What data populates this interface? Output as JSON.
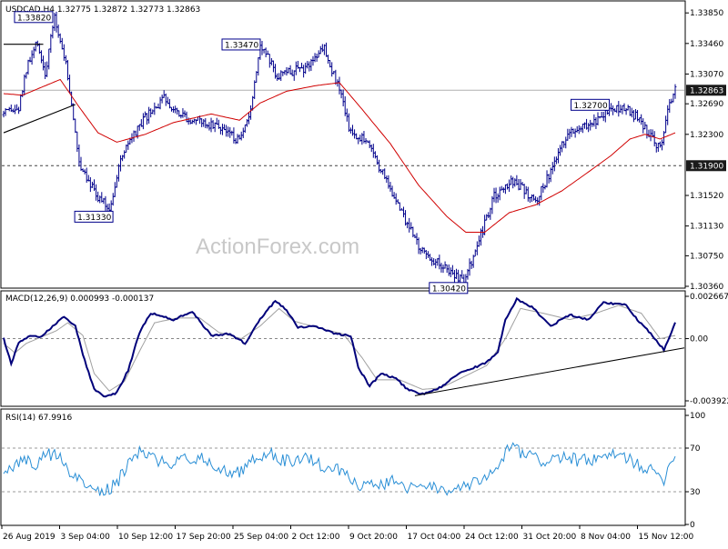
{
  "watermark": "ActionForex.com",
  "colors": {
    "price": "#00008b",
    "ma": "#d00000",
    "macd": "#00007a",
    "signal": "#a0a0a0",
    "rsi": "#2a8fd6",
    "trend": "#000000",
    "level_box": "#1a1a1a",
    "label_border": "#00008b"
  },
  "chart_data": [
    {
      "type": "bar",
      "title": "USDCAD,H4  1.32775 1.32872 1.32773 1.32863",
      "ylim": [
        1.3036,
        1.3398
      ],
      "yticks": [
        "1.33850",
        "1.33460",
        "1.33070",
        "1.32690",
        "1.32300",
        "1.31520",
        "1.31130",
        "1.30750",
        "1.30360"
      ],
      "ytick_values": [
        1.3385,
        1.3346,
        1.3307,
        1.3269,
        1.323,
        1.3152,
        1.3113,
        1.3075,
        1.3036
      ],
      "xtick_labels": [
        "26 Aug 2019",
        "3 Sep 04:00",
        "10 Sep 12:00",
        "17 Sep 20:00",
        "25 Sep 04:00",
        "2 Oct 12:00",
        "9 Oct 20:00",
        "17 Oct 04:00",
        "24 Oct 12:00",
        "31 Oct 20:00",
        "8 Nov 04:00",
        "15 Nov 12:00"
      ],
      "price_keypoints": [
        [
          0,
          1.3255
        ],
        [
          8,
          1.3262
        ],
        [
          12,
          1.3312
        ],
        [
          18,
          1.3348
        ],
        [
          22,
          1.3305
        ],
        [
          27,
          1.338
        ],
        [
          33,
          1.332
        ],
        [
          40,
          1.3195
        ],
        [
          50,
          1.315
        ],
        [
          56,
          1.3135
        ],
        [
          63,
          1.3205
        ],
        [
          75,
          1.325
        ],
        [
          85,
          1.3275
        ],
        [
          98,
          1.325
        ],
        [
          115,
          1.324
        ],
        [
          125,
          1.322
        ],
        [
          130,
          1.3248
        ],
        [
          136,
          1.3347
        ],
        [
          145,
          1.3305
        ],
        [
          160,
          1.3315
        ],
        [
          170,
          1.3342
        ],
        [
          178,
          1.3285
        ],
        [
          184,
          1.3232
        ],
        [
          192,
          1.3225
        ],
        [
          200,
          1.3185
        ],
        [
          212,
          1.3125
        ],
        [
          222,
          1.308
        ],
        [
          232,
          1.3064
        ],
        [
          244,
          1.3042
        ],
        [
          252,
          1.3094
        ],
        [
          260,
          1.315
        ],
        [
          270,
          1.317
        ],
        [
          282,
          1.3145
        ],
        [
          290,
          1.3182
        ],
        [
          300,
          1.3236
        ],
        [
          312,
          1.3245
        ],
        [
          322,
          1.3261
        ],
        [
          330,
          1.3266
        ],
        [
          337,
          1.3247
        ],
        [
          344,
          1.3225
        ],
        [
          348,
          1.3212
        ],
        [
          352,
          1.3262
        ],
        [
          356,
          1.3286
        ]
      ],
      "ma_keypoints": [
        [
          0,
          1.3282
        ],
        [
          10,
          1.328
        ],
        [
          22,
          1.3292
        ],
        [
          30,
          1.33
        ],
        [
          40,
          1.3265
        ],
        [
          50,
          1.3232
        ],
        [
          60,
          1.322
        ],
        [
          75,
          1.323
        ],
        [
          90,
          1.3245
        ],
        [
          110,
          1.3256
        ],
        [
          125,
          1.3248
        ],
        [
          136,
          1.327
        ],
        [
          150,
          1.3285
        ],
        [
          165,
          1.3292
        ],
        [
          178,
          1.3296
        ],
        [
          190,
          1.3262
        ],
        [
          205,
          1.3218
        ],
        [
          220,
          1.3165
        ],
        [
          235,
          1.3125
        ],
        [
          245,
          1.3105
        ],
        [
          255,
          1.3105
        ],
        [
          268,
          1.313
        ],
        [
          282,
          1.314
        ],
        [
          296,
          1.3158
        ],
        [
          310,
          1.3182
        ],
        [
          322,
          1.3203
        ],
        [
          332,
          1.3224
        ],
        [
          340,
          1.323
        ],
        [
          348,
          1.3224
        ],
        [
          356,
          1.3232
        ]
      ],
      "current": {
        "label": "1.32863",
        "value": 1.32863
      },
      "level": {
        "label": "1.31900",
        "value": 1.319
      },
      "labels": [
        {
          "text": "1.33820",
          "i": 27,
          "value": 1.3382
        },
        {
          "text": "1.31330",
          "i": 56,
          "value": 1.3133
        },
        {
          "text": "1.33470",
          "i": 137,
          "value": 1.3347
        },
        {
          "text": "1.30420",
          "i": 244,
          "value": 1.3042
        },
        {
          "text": "1.32700",
          "i": 322,
          "value": 1.327
        }
      ],
      "trendlines": [
        {
          "from": [
            0,
            1.3232
          ],
          "to": [
            38,
            1.3268
          ]
        },
        {
          "from": [
            0,
            1.3345
          ],
          "to": [
            21,
            1.3345
          ]
        }
      ]
    },
    {
      "type": "line",
      "title": "MACD(12,26,9) 0.000993 -0.000137",
      "ylim": [
        -0.003922,
        0.002667
      ],
      "yticks": [
        "0.002667",
        "0.00",
        "-0.003922"
      ],
      "ytick_values": [
        0.002667,
        0.0,
        -0.003922
      ],
      "macd_keypoints": [
        [
          0,
          0.0
        ],
        [
          4,
          -0.0016
        ],
        [
          8,
          -0.0002
        ],
        [
          14,
          0.0002
        ],
        [
          20,
          0.0001
        ],
        [
          26,
          0.0008
        ],
        [
          32,
          0.0014
        ],
        [
          38,
          0.0008
        ],
        [
          42,
          -0.001
        ],
        [
          48,
          -0.0032
        ],
        [
          54,
          -0.0037
        ],
        [
          60,
          -0.0034
        ],
        [
          66,
          -0.002
        ],
        [
          72,
          0.0004
        ],
        [
          78,
          0.0016
        ],
        [
          90,
          0.0012
        ],
        [
          100,
          0.0017
        ],
        [
          110,
          0.0002
        ],
        [
          120,
          0.0003
        ],
        [
          128,
          -0.0003
        ],
        [
          136,
          0.0012
        ],
        [
          144,
          0.0024
        ],
        [
          150,
          0.0018
        ],
        [
          156,
          0.0007
        ],
        [
          164,
          0.0008
        ],
        [
          176,
          0.0003
        ],
        [
          184,
          0.0002
        ],
        [
          188,
          -0.0018
        ],
        [
          194,
          -0.003
        ],
        [
          200,
          -0.0022
        ],
        [
          208,
          -0.0025
        ],
        [
          214,
          -0.0032
        ],
        [
          222,
          -0.0035
        ],
        [
          230,
          -0.0032
        ],
        [
          240,
          -0.0023
        ],
        [
          250,
          -0.0018
        ],
        [
          256,
          -0.0015
        ],
        [
          262,
          -0.0008
        ],
        [
          266,
          0.0012
        ],
        [
          272,
          0.0025
        ],
        [
          280,
          0.002
        ],
        [
          290,
          0.0008
        ],
        [
          300,
          0.0015
        ],
        [
          310,
          0.0012
        ],
        [
          318,
          0.0023
        ],
        [
          330,
          0.0021
        ],
        [
          336,
          0.0012
        ],
        [
          344,
          0.0002
        ],
        [
          350,
          -0.0007
        ],
        [
          356,
          0.001
        ]
      ],
      "signal_keypoints": [
        [
          0,
          -0.0003
        ],
        [
          6,
          -0.0009
        ],
        [
          12,
          -0.0003
        ],
        [
          20,
          0.0001
        ],
        [
          28,
          0.0005
        ],
        [
          34,
          0.001
        ],
        [
          42,
          0.0002
        ],
        [
          48,
          -0.0022
        ],
        [
          56,
          -0.0033
        ],
        [
          64,
          -0.0027
        ],
        [
          72,
          -0.0008
        ],
        [
          80,
          0.001
        ],
        [
          92,
          0.0013
        ],
        [
          104,
          0.0013
        ],
        [
          114,
          0.0004
        ],
        [
          126,
          0.0
        ],
        [
          136,
          0.0008
        ],
        [
          146,
          0.0019
        ],
        [
          154,
          0.0011
        ],
        [
          166,
          0.0007
        ],
        [
          180,
          0.0003
        ],
        [
          190,
          -0.0012
        ],
        [
          198,
          -0.0026
        ],
        [
          210,
          -0.0026
        ],
        [
          222,
          -0.0032
        ],
        [
          232,
          -0.0031
        ],
        [
          244,
          -0.0024
        ],
        [
          256,
          -0.0017
        ],
        [
          266,
          0.0
        ],
        [
          274,
          0.0019
        ],
        [
          286,
          0.0016
        ],
        [
          300,
          0.0012
        ],
        [
          314,
          0.0016
        ],
        [
          326,
          0.0021
        ],
        [
          338,
          0.0016
        ],
        [
          348,
          0.0
        ],
        [
          356,
          0.0002
        ]
      ],
      "trendline": {
        "from": [
          218,
          -0.0036
        ],
        "to": [
          356,
          -0.0007
        ]
      }
    },
    {
      "type": "line",
      "title": "RSI(14) 67.9916",
      "ylim": [
        0,
        100
      ],
      "yticks": [
        "100",
        "70",
        "30",
        "0"
      ],
      "ytick_values": [
        100,
        70,
        30,
        0
      ],
      "levels": [
        70,
        30
      ],
      "rsi_keypoints": [
        [
          0,
          45
        ],
        [
          4,
          52
        ],
        [
          10,
          60
        ],
        [
          16,
          54
        ],
        [
          22,
          62
        ],
        [
          27,
          66
        ],
        [
          32,
          56
        ],
        [
          36,
          44
        ],
        [
          40,
          40
        ],
        [
          46,
          36
        ],
        [
          54,
          30
        ],
        [
          60,
          38
        ],
        [
          66,
          55
        ],
        [
          72,
          66
        ],
        [
          80,
          60
        ],
        [
          90,
          55
        ],
        [
          100,
          62
        ],
        [
          110,
          58
        ],
        [
          120,
          46
        ],
        [
          126,
          48
        ],
        [
          134,
          62
        ],
        [
          140,
          66
        ],
        [
          150,
          58
        ],
        [
          160,
          62
        ],
        [
          168,
          54
        ],
        [
          176,
          52
        ],
        [
          184,
          44
        ],
        [
          190,
          34
        ],
        [
          198,
          36
        ],
        [
          206,
          40
        ],
        [
          214,
          34
        ],
        [
          222,
          32
        ],
        [
          230,
          34
        ],
        [
          240,
          30
        ],
        [
          248,
          36
        ],
        [
          256,
          44
        ],
        [
          262,
          50
        ],
        [
          268,
          72
        ],
        [
          276,
          64
        ],
        [
          286,
          58
        ],
        [
          296,
          62
        ],
        [
          306,
          58
        ],
        [
          316,
          60
        ],
        [
          326,
          64
        ],
        [
          336,
          56
        ],
        [
          344,
          48
        ],
        [
          350,
          42
        ],
        [
          356,
          68
        ]
      ]
    }
  ]
}
